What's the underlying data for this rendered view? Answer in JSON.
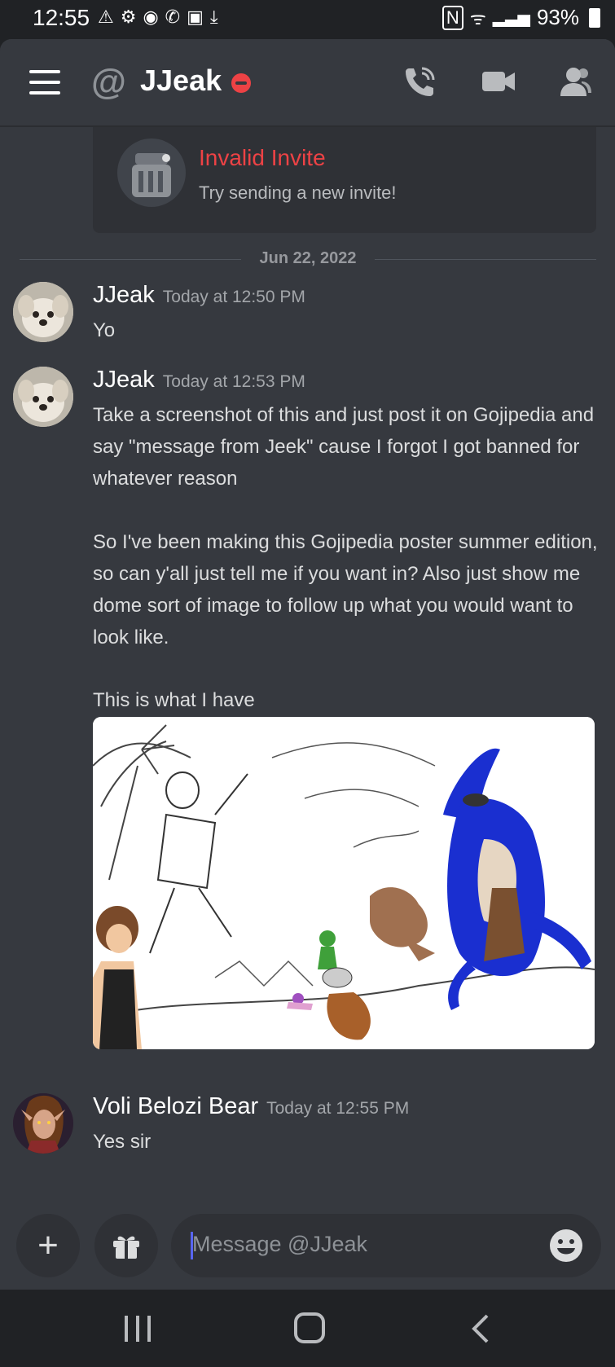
{
  "status_bar": {
    "time": "12:55",
    "battery": "93%"
  },
  "header": {
    "title": "JJeak",
    "status": "do-not-disturb",
    "icons": [
      "hamburger-icon",
      "at-icon",
      "phone-call-icon",
      "video-icon",
      "members-icon"
    ]
  },
  "invite": {
    "title": "Invalid Invite",
    "subtitle": "Try sending a new invite!"
  },
  "date_divider": "Jun 22, 2022",
  "messages": [
    {
      "author": "JJeak",
      "timestamp": "Today at 12:50 PM",
      "text": "Yo"
    },
    {
      "author": "JJeak",
      "timestamp": "Today at 12:53 PM",
      "paragraphs": [
        "Take a screenshot of this and just post it on Gojipedia and say \"message from Jeek\" cause I forgot I got banned for whatever reason",
        "So I've been making this Gojipedia poster summer edition, so can y'all just tell me if you want in? Also just show me dome sort of image to follow up what you would want to look like.",
        "This is what I have"
      ]
    },
    {
      "author": "Voli Belozi Bear",
      "timestamp": "Today at 12:55 PM",
      "text": "Yes sir"
    }
  ],
  "composer": {
    "placeholder": "Message @JJeak"
  },
  "colors": {
    "background": "#36393f",
    "header": "#36393f",
    "dnd_red": "#ed4245",
    "invite_red": "#ed4245",
    "text": "#dcddde"
  }
}
